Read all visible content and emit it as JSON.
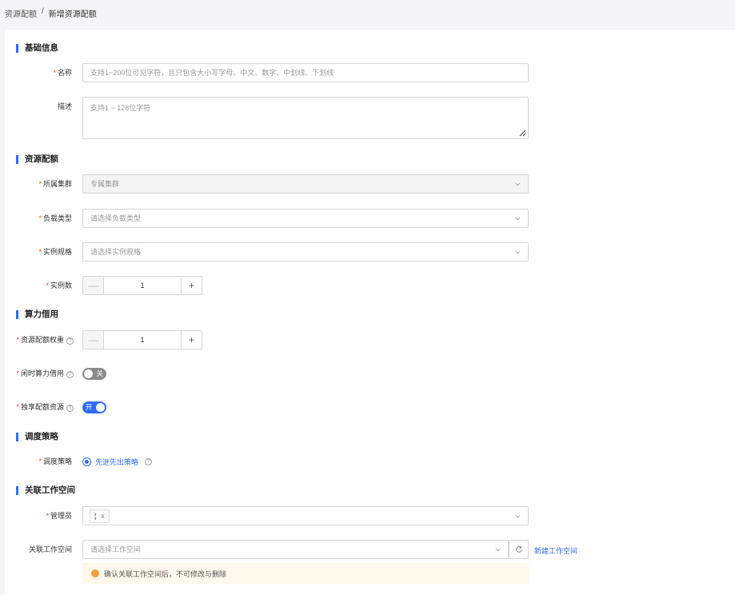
{
  "breadcrumb": {
    "parent": "资源配额",
    "separator": "/",
    "current": "新增资源配额"
  },
  "sections": {
    "basic": "基础信息",
    "quota": "资源配额",
    "borrow": "算力借用",
    "schedule": "调度策略",
    "workspace": "关联工作空间"
  },
  "form": {
    "name": {
      "label": "名称",
      "placeholder": "支持1~200位可见字符，且只包含大小写字母、中文、数字、中划线、下划线"
    },
    "desc": {
      "label": "描述",
      "placeholder": "支持1 ~ 128位字符"
    },
    "cluster": {
      "label": "所属集群",
      "value": "专属集群"
    },
    "workload": {
      "label": "负载类型",
      "placeholder": "请选择负载类型"
    },
    "spec": {
      "label": "实例规格",
      "placeholder": "请选择实例规格"
    },
    "instances": {
      "label": "实例数",
      "value": "1",
      "minus": "—",
      "plus": "+"
    },
    "weight": {
      "label": "资源配额权重",
      "value": "1",
      "minus": "—",
      "plus": "+"
    },
    "idle_borrow": {
      "label": "闲时算力借用",
      "state": "关"
    },
    "exclusive": {
      "label": "独享配额资源",
      "state": "开"
    },
    "strategy": {
      "label": "调度策略",
      "option": "先进先出策略"
    },
    "admin": {
      "label": "管理员",
      "tag": "¦",
      "tag_close": "x"
    },
    "workspace": {
      "label": "关联工作空间",
      "placeholder": "请选择工作空间",
      "new_link": "新建工作空间"
    },
    "warning": "确认关联工作空间后，不可修改与删除"
  },
  "help_glyph": "?",
  "required_mark": "*",
  "colors": {
    "accent": "#2f6bff",
    "required": "#f04134",
    "warning": "#f5a040"
  }
}
